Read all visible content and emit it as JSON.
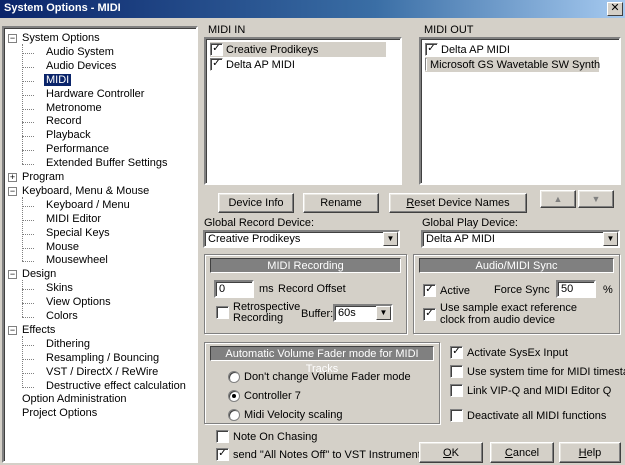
{
  "window": {
    "title": "System Options - MIDI",
    "close_glyph": "✕"
  },
  "tree": {
    "items": [
      {
        "label": "System Options",
        "level": 0,
        "toggle": "−"
      },
      {
        "label": "Audio System",
        "level": 1
      },
      {
        "label": "Audio Devices",
        "level": 1
      },
      {
        "label": "MIDI",
        "level": 1,
        "selected": true
      },
      {
        "label": "Hardware Controller",
        "level": 1
      },
      {
        "label": "Metronome",
        "level": 1
      },
      {
        "label": "Record",
        "level": 1
      },
      {
        "label": "Playback",
        "level": 1
      },
      {
        "label": "Performance",
        "level": 1
      },
      {
        "label": "Extended Buffer Settings",
        "level": 1
      },
      {
        "label": "Program",
        "level": 0,
        "toggle": "+"
      },
      {
        "label": "Keyboard, Menu & Mouse",
        "level": 0,
        "toggle": "−"
      },
      {
        "label": "Keyboard / Menu",
        "level": 1
      },
      {
        "label": "MIDI Editor",
        "level": 1
      },
      {
        "label": "Special Keys",
        "level": 1
      },
      {
        "label": "Mouse",
        "level": 1
      },
      {
        "label": "Mousewheel",
        "level": 1
      },
      {
        "label": "Design",
        "level": 0,
        "toggle": "−"
      },
      {
        "label": "Skins",
        "level": 1
      },
      {
        "label": "View Options",
        "level": 1
      },
      {
        "label": "Colors",
        "level": 1
      },
      {
        "label": "Effects",
        "level": 0,
        "toggle": "−"
      },
      {
        "label": "Dithering",
        "level": 1
      },
      {
        "label": "Resampling / Bouncing",
        "level": 1
      },
      {
        "label": "VST / DirectX / ReWire",
        "level": 1
      },
      {
        "label": "Destructive effect calculation",
        "level": 1
      },
      {
        "label": "Option Administration",
        "level": 0
      },
      {
        "label": "Project Options",
        "level": 0
      }
    ]
  },
  "midi_in": {
    "label": "MIDI IN",
    "devices": [
      {
        "name": "Creative Prodikeys",
        "checked": true,
        "highlight": true
      },
      {
        "name": "Delta AP MIDI",
        "checked": true,
        "highlight": false
      }
    ]
  },
  "midi_out": {
    "label": "MIDI OUT",
    "devices": [
      {
        "name": "Delta AP MIDI",
        "checked": true,
        "highlight": false
      },
      {
        "name": "Microsoft GS Wavetable SW Synth",
        "checked": false,
        "highlight": true
      }
    ]
  },
  "buttons": {
    "device_info": "Device Info",
    "rename": "Rename",
    "reset_device_names_ak": "R",
    "reset_device_names_rest": "eset Device Names",
    "up": "▲",
    "down": "▼",
    "ok_ak": "O",
    "ok_rest": "K",
    "cancel_ak": "C",
    "cancel_rest": "ancel",
    "help_ak": "H",
    "help_rest": "elp"
  },
  "global_record": {
    "label": "Global Record Device:",
    "value": "Creative Prodikeys"
  },
  "global_play": {
    "label": "Global Play Device:",
    "value": "Delta AP MIDI"
  },
  "midi_recording": {
    "title": "MIDI Recording",
    "offset_value": "0",
    "offset_unit": "ms",
    "offset_label": "Record Offset",
    "retro_label_1": "Retrospective",
    "retro_label_2": "Recording",
    "retro_checked": false,
    "buffer_label": "Buffer:",
    "buffer_value": "60s"
  },
  "audio_sync": {
    "title": "Audio/MIDI Sync",
    "active_label": "Active",
    "active_checked": true,
    "force_sync_label": "Force Sync",
    "force_sync_value": "50",
    "force_sync_unit": "%",
    "exact_label_1": "Use sample exact reference",
    "exact_label_2": "clock from audio device",
    "exact_checked": true
  },
  "fader_mode": {
    "title": "Automatic Volume Fader mode for MIDI Tracks",
    "options": [
      {
        "label": "Don't change Volume Fader mode",
        "selected": false
      },
      {
        "label": "Controller 7",
        "selected": true
      },
      {
        "label": "Midi Velocity scaling",
        "selected": false
      }
    ]
  },
  "right_options": [
    {
      "label": "Activate SysEx Input",
      "checked": true
    },
    {
      "label": "Use system time for MIDI timestamps",
      "checked": false
    },
    {
      "label": "Link VIP-Q and MIDI Editor Q",
      "checked": false
    },
    {
      "label": "Deactivate all MIDI functions",
      "checked": false
    }
  ],
  "bottom_options": [
    {
      "label": "Note On Chasing",
      "checked": false
    },
    {
      "label": "send \"All Notes Off\" to VST Instruments",
      "checked": true
    }
  ],
  "glyphs": {
    "check": "✓",
    "combo_arrow": "▼"
  }
}
